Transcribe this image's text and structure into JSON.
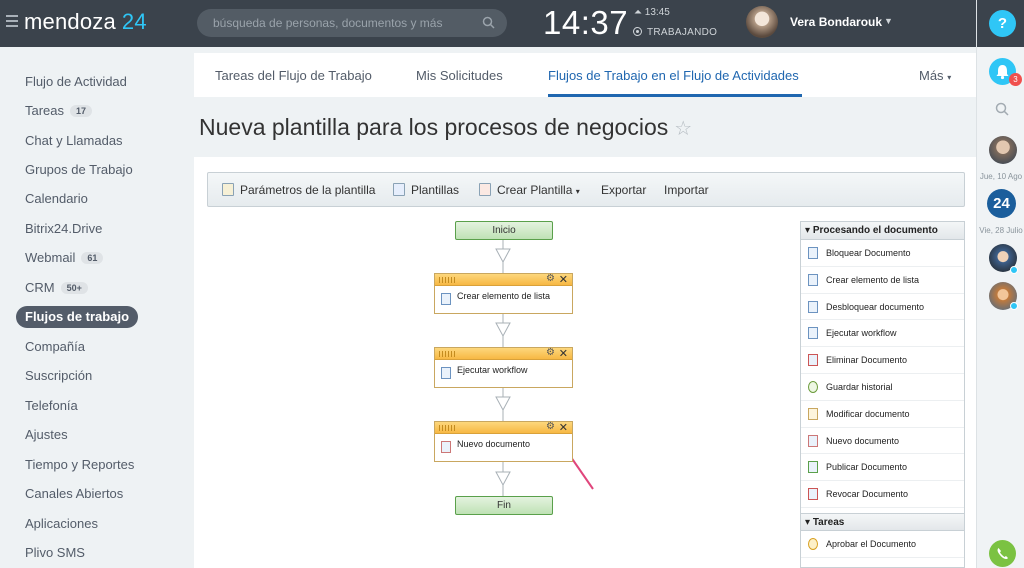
{
  "header": {
    "logo_text": "mendoza",
    "logo_num": "24",
    "search_placeholder": "búsqueda de personas, documentos y más",
    "clock": "14:37",
    "alarm": "13:45",
    "status": "TRABAJANDO",
    "user_name": "Vera Bondarouk"
  },
  "rail": {
    "help": "?",
    "notification_count": "3",
    "date1": "Jue, 10 Ago",
    "logo24": "24",
    "date2": "Vie, 28 Julio"
  },
  "sidebar": {
    "items": [
      {
        "label": "Flujo de Actividad"
      },
      {
        "label": "Tareas",
        "badge": "17"
      },
      {
        "label": "Chat y Llamadas"
      },
      {
        "label": "Grupos de Trabajo"
      },
      {
        "label": "Calendario"
      },
      {
        "label": "Bitrix24.Drive"
      },
      {
        "label": "Webmail",
        "badge": "61"
      },
      {
        "label": "CRM",
        "badge": "50+"
      },
      {
        "label": "Flujos de trabajo",
        "active": true
      },
      {
        "label": "Compañía"
      },
      {
        "label": "Suscripción"
      },
      {
        "label": "Telefonía"
      },
      {
        "label": "Ajustes"
      },
      {
        "label": "Tiempo y Reportes"
      },
      {
        "label": "Canales Abiertos"
      },
      {
        "label": "Aplicaciones"
      },
      {
        "label": "Plivo SMS"
      }
    ]
  },
  "tabs": [
    {
      "label": "Tareas del Flujo de Trabajo"
    },
    {
      "label": "Mis Solicitudes"
    },
    {
      "label": "Flujos de Trabajo en el Flujo de Actividades",
      "active": true
    },
    {
      "label": "Más"
    }
  ],
  "page": {
    "title": "Nueva plantilla para los procesos de negocios"
  },
  "toolbar": {
    "params": "Parámetros de la plantilla",
    "templates": "Plantillas",
    "create": "Crear Plantilla",
    "export": "Exportar",
    "import": "Importar"
  },
  "diagram": {
    "start": "Inicio",
    "end": "Fin",
    "blocks": [
      {
        "label": "Crear elemento de lista"
      },
      {
        "label": "Ejecutar workflow"
      },
      {
        "label": "Nuevo documento"
      }
    ]
  },
  "activities": {
    "group1": "Procesando el documento",
    "items": [
      "Bloquear Documento",
      "Crear elemento de lista",
      "Desbloquear documento",
      "Ejecutar workflow",
      "Eliminar Documento",
      "Guardar historial",
      "Modificar documento",
      "Nuevo documento",
      "Publicar Documento",
      "Revocar Documento"
    ],
    "group2": "Tareas",
    "items2": [
      "Aprobar el Documento"
    ]
  },
  "colors": {
    "header_bg": "#3b434c",
    "accent": "#2fc6f6",
    "tab_active": "#2067b0",
    "block_head": "#f7b844",
    "pill_green": "#bfe2b5",
    "arrow": "#e0467c"
  }
}
